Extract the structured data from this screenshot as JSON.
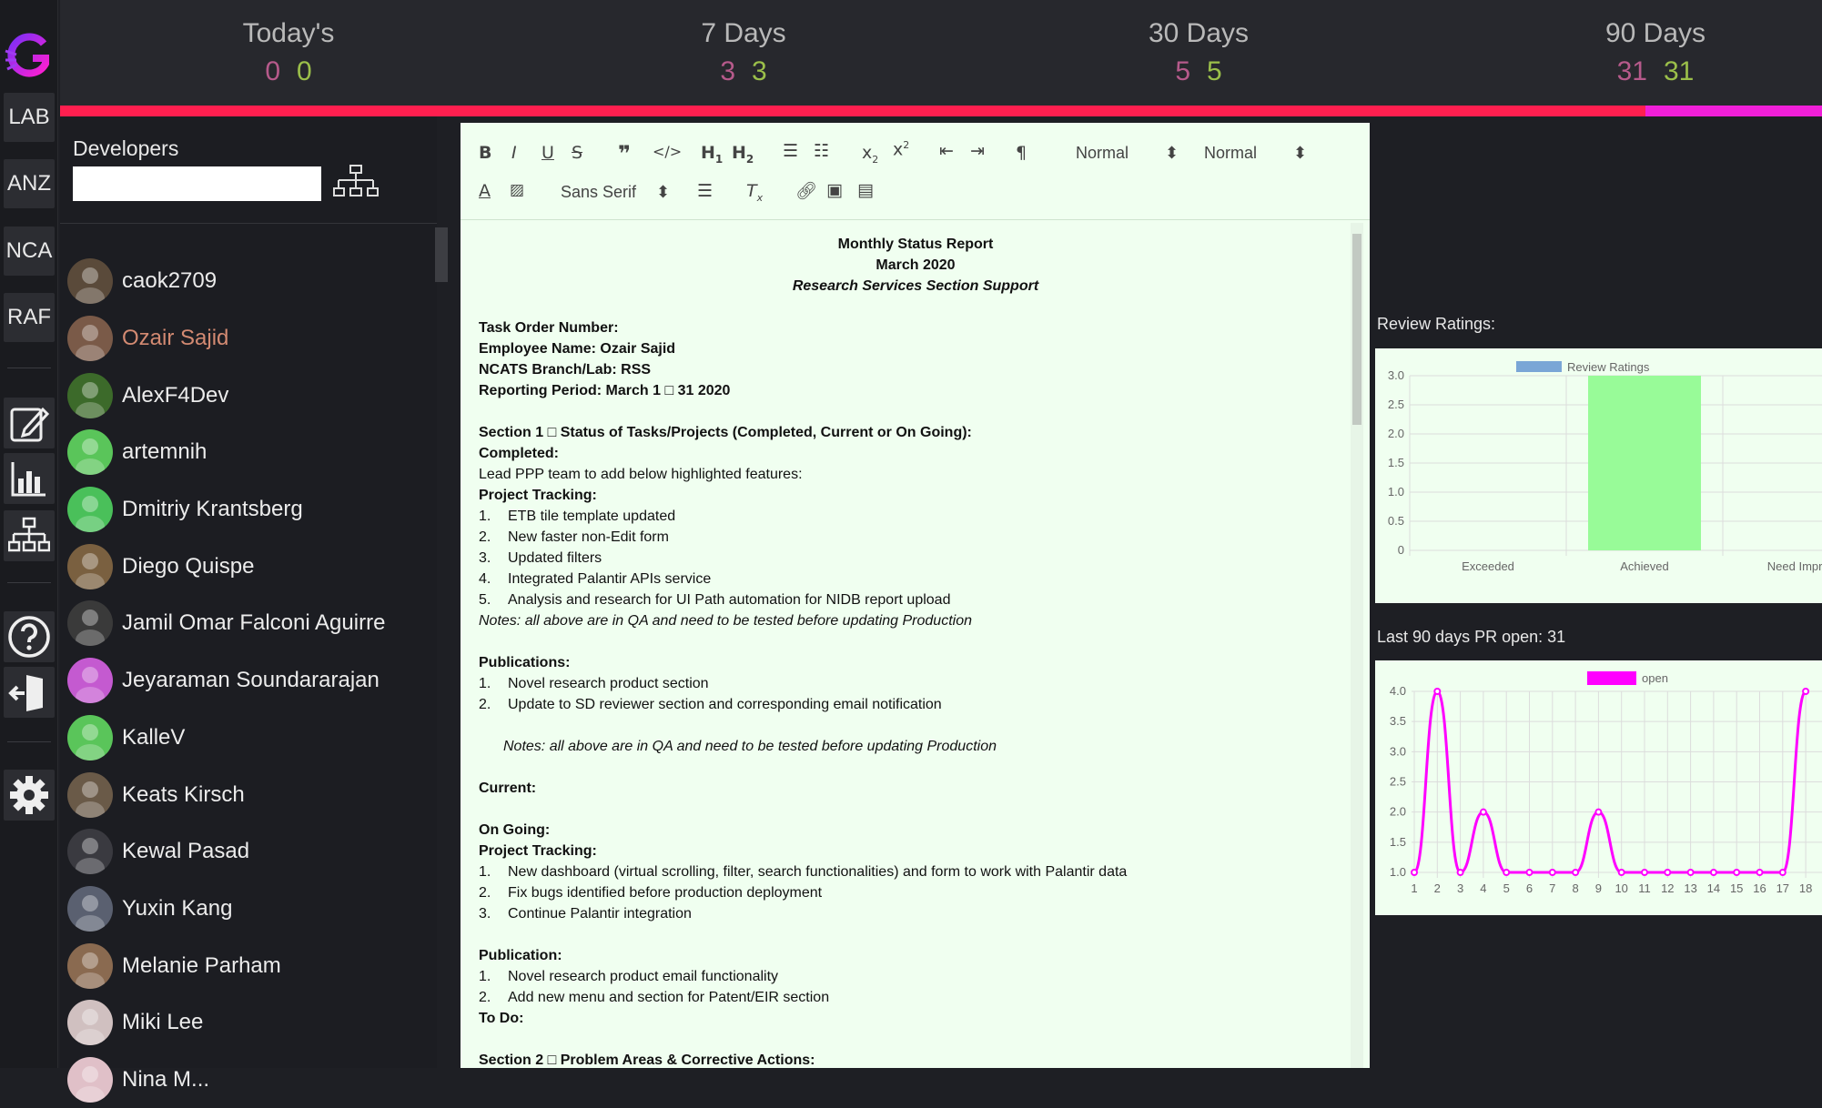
{
  "nav": {
    "buttons": [
      "LAB",
      "ANZ",
      "NCA",
      "RAF"
    ],
    "icons": [
      "edit-icon",
      "bar-chart-icon",
      "org-chart-icon",
      "help-icon",
      "logout-icon",
      "settings-icon"
    ]
  },
  "stats": [
    {
      "label": "Today's",
      "a": "0",
      "b": "0"
    },
    {
      "label": "7 Days",
      "a": "3",
      "b": "3"
    },
    {
      "label": "30 Days",
      "a": "5",
      "b": "5"
    },
    {
      "label": "90 Days",
      "a": "31",
      "b": "31"
    }
  ],
  "progress": {
    "fraction_secondary": 0.1
  },
  "developers": {
    "title": "Developers",
    "search_placeholder": "",
    "items": [
      {
        "name": "caok2709",
        "active": false
      },
      {
        "name": "Ozair Sajid",
        "active": true
      },
      {
        "name": "AlexF4Dev",
        "active": false
      },
      {
        "name": "artemnih",
        "active": false
      },
      {
        "name": "Dmitriy Krantsberg",
        "active": false
      },
      {
        "name": "Diego Quispe",
        "active": false
      },
      {
        "name": "Jamil Omar Falconi Aguirre",
        "active": false
      },
      {
        "name": "Jeyaraman Soundararajan",
        "active": false
      },
      {
        "name": "KalleV",
        "active": false
      },
      {
        "name": "Keats Kirsch",
        "active": false
      },
      {
        "name": "Kewal Pasad",
        "active": false
      },
      {
        "name": "Yuxin Kang",
        "active": false
      },
      {
        "name": "Melanie Parham",
        "active": false
      },
      {
        "name": "Miki Lee",
        "active": false
      },
      {
        "name": "Nina M...",
        "active": false
      }
    ]
  },
  "toolbar": {
    "header_select": "Normal",
    "size_select": "Normal",
    "font_select": "Sans Serif"
  },
  "doc": {
    "title": "Monthly Status Report",
    "date": "March 2020",
    "subtitle": "Research Services Section Support",
    "task_order": "Task Order Number:",
    "employee": "Employee Name: Ozair Sajid",
    "branch": "NCATS Branch/Lab:  RSS",
    "period": "Reporting Period: March 1 □ 31 2020",
    "section1": "Section 1 □ Status of Tasks/Projects (Completed, Current or On Going):",
    "completed": "Completed:",
    "lead": "Lead PPP team to add below highlighted features:",
    "project_tracking": "Project Tracking:",
    "completed_items": [
      "ETB tile template updated",
      "New faster non-Edit form",
      "Updated filters",
      "Integrated Palantir APIs service",
      "Analysis and research for UI Path automation for NIDB report upload"
    ],
    "notes1": "Notes: all above are in QA and need to be tested before updating Production",
    "publications": "Publications:",
    "pub_items": [
      "Novel research product section",
      "Update to SD reviewer section and corresponding email notification"
    ],
    "notes2": "Notes: all above are in QA and need to be tested before updating Production",
    "current": "Current:",
    "ongoing": "On Going:",
    "project_tracking2": "Project Tracking:",
    "ongoing_items": [
      "New dashboard (virtual scrolling, filter, search functionalities) and form to work with Palantir data",
      "Fix bugs identified before production deployment",
      "Continue Palantir integration"
    ],
    "publication2": "Publication:",
    "pub2_items": [
      "Novel research product email functionality",
      "Add new menu and section for Patent/EIR section"
    ],
    "todo": "To Do:",
    "section2": "Section 2 □ Problem Areas & Corrective Actions:"
  },
  "review_label": "Review Ratings:",
  "pr_label": "Last 90 days PR open: 31",
  "chart_data": [
    {
      "type": "bar",
      "legend": [
        "Review Ratings"
      ],
      "categories": [
        "Exceeded",
        "Achieved",
        "Need Improv"
      ],
      "values": [
        0,
        3,
        0
      ],
      "yticks": [
        "0",
        "0.5",
        "1.0",
        "1.5",
        "2.0",
        "2.5",
        "3.0"
      ],
      "ylim": [
        0,
        3
      ],
      "color": "#98fb98",
      "legend_color": "#7aa6d6"
    },
    {
      "type": "line",
      "legend": [
        "open"
      ],
      "x": [
        "1",
        "2",
        "3",
        "4",
        "5",
        "6",
        "7",
        "8",
        "9",
        "10",
        "11",
        "12",
        "13",
        "14",
        "15",
        "16",
        "17",
        "18"
      ],
      "values": [
        1,
        4,
        1,
        2,
        1,
        1,
        1,
        1,
        2,
        1,
        1,
        1,
        1,
        1,
        1,
        1,
        1,
        4
      ],
      "yticks": [
        "1.0",
        "1.5",
        "2.0",
        "2.5",
        "3.0",
        "3.5",
        "4.0"
      ],
      "ylim": [
        1,
        4
      ],
      "color": "#ff00ff"
    }
  ]
}
